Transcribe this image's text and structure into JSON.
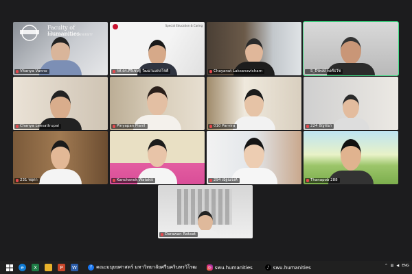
{
  "window": {
    "app": "Zoom Meeting - Gallery View"
  },
  "slide": {
    "title": "Faculty of Humanities",
    "subtitle": "SRINAKHARINWIROT UNIVERSITY"
  },
  "participants": [
    {
      "name": "Vitanya Vanno",
      "muted": true
    },
    {
      "name": "รศ.ดร.ศิริเชษฐ์ วัฒนามงคลโชติ",
      "muted": true
    },
    {
      "name": "Chayanut Laksanavicharn",
      "muted": true
    },
    {
      "name": "S_ธีรพงษ์ พงศ์ธวัช",
      "muted": false,
      "active": true
    },
    {
      "name": "Chanya Leesattrupai",
      "muted": true
    },
    {
      "name": "Pinyapan Pianil",
      "muted": true
    },
    {
      "name": "010 Parvira",
      "muted": true
    },
    {
      "name": "224 ธัญชนก",
      "muted": true
    },
    {
      "name": "231 ทยุดา",
      "muted": true
    },
    {
      "name": "Kanchanok Watakit",
      "muted": true
    },
    {
      "name": "294 ณัฐณรงค์",
      "muted": true
    },
    {
      "name": "Thanapob 288",
      "muted": true
    },
    {
      "name": "Darawan Raksat",
      "muted": true
    }
  ],
  "tile_labels": {
    "t2_top": "Special Education & Caring"
  },
  "taskbar": {
    "facebook": "คณะมนุษยศาสตร์ มหาวิทยาลัยศรีนครินทรวิโรฒ",
    "instagram": "swu.humanities",
    "tiktok": "swu.humanities",
    "lang": "ENG"
  },
  "colors": {
    "active_border": "#3ddc84",
    "background": "#1c1c1e",
    "taskbar": "#202020"
  }
}
